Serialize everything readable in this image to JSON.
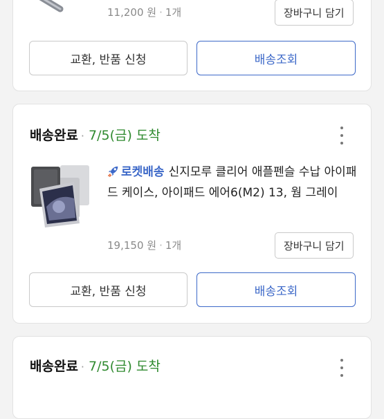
{
  "order1": {
    "meta_price": "11,200 원",
    "meta_qty": "1개",
    "cart_label": "장바구니 담기",
    "exchange_label": "교환, 반품 신청",
    "track_label": "배송조회"
  },
  "order2": {
    "status": "배송완료",
    "date": "7/5(금)",
    "arrive": "도착",
    "rocket_label": "로켓배송",
    "product_title": "신지모루 클리어 애플펜슬 수납 아이패드 케이스, 아이패드 에어6(M2) 13, 웜 그레이",
    "meta_price": "19,150 원",
    "meta_qty": "1개",
    "cart_label": "장바구니 담기",
    "exchange_label": "교환, 반품 신청",
    "track_label": "배송조회"
  },
  "order3": {
    "status": "배송완료",
    "date": "7/5(금)",
    "arrive": "도착"
  },
  "colors": {
    "accent_blue": "#3c68c8",
    "delivered_green": "#2f8a2f"
  }
}
